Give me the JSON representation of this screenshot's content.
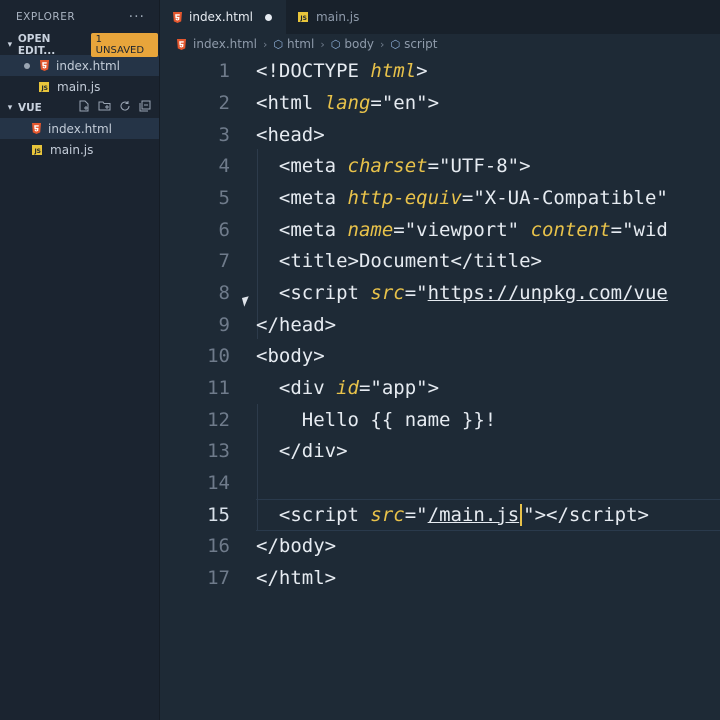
{
  "sidebar": {
    "title": "EXPLORER",
    "more": "···",
    "open_editors": {
      "label": "OPEN EDIT...",
      "badge": "1 UNSAVED",
      "files": [
        {
          "name": "index.html"
        },
        {
          "name": "main.js"
        }
      ]
    },
    "folder": {
      "label": "VUE",
      "files": [
        {
          "name": "index.html"
        },
        {
          "name": "main.js"
        }
      ]
    }
  },
  "tabs": [
    {
      "label": "index.html",
      "active": true,
      "unsaved": true
    },
    {
      "label": "main.js",
      "active": false
    }
  ],
  "breadcrumb": [
    "index.html",
    "html",
    "body",
    "script"
  ],
  "editor": {
    "current_line": 15,
    "lines": [
      "1",
      "2",
      "3",
      "4",
      "5",
      "6",
      "7",
      "8",
      "9",
      "10",
      "11",
      "12",
      "13",
      "14",
      "15",
      "16",
      "17"
    ]
  },
  "colors": {
    "accent": "#e8a53b",
    "attr": "#e8c24a",
    "bg": "#1e2a36"
  }
}
